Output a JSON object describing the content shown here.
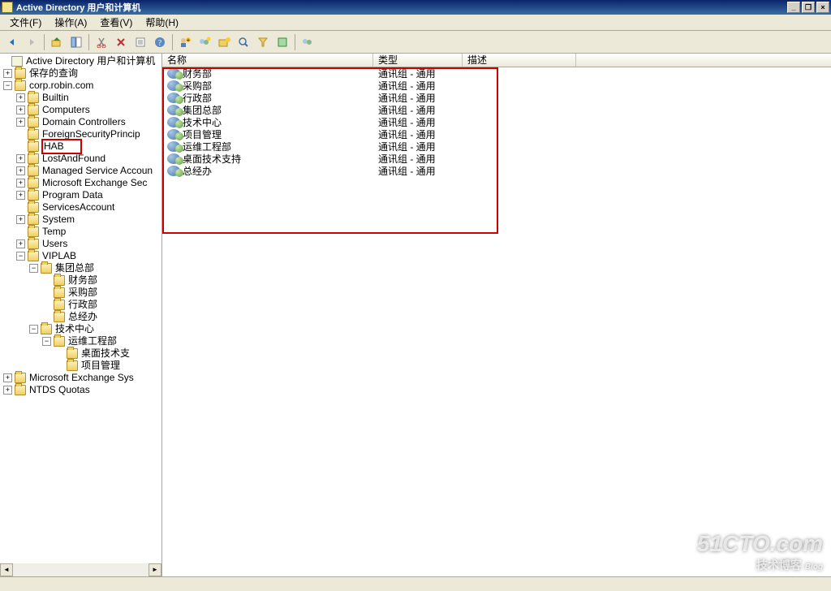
{
  "window": {
    "title": "Active Directory 用户和计算机"
  },
  "menu": {
    "file": "文件(F)",
    "action": "操作(A)",
    "view": "查看(V)",
    "help": "帮助(H)"
  },
  "tree": {
    "root": "Active Directory 用户和计算机",
    "saved_queries": "保存的查询",
    "domain": "corp.robin.com",
    "builtin": "Builtin",
    "computers": "Computers",
    "domain_controllers": "Domain Controllers",
    "foreign_sp": "ForeignSecurityPrincip",
    "hab": "HAB",
    "lostandfound": "LostAndFound",
    "managed_svc": "Managed Service Accoun",
    "ms_exch_sec": "Microsoft Exchange Sec",
    "program_data": "Program Data",
    "services_account": "ServicesAccount",
    "system": "System",
    "temp": "Temp",
    "users": "Users",
    "viplab": "VIPLAB",
    "grp_hq": "集团总部",
    "dept_finance": "财务部",
    "dept_purchase": "采购部",
    "dept_admin": "行政部",
    "dept_gm": "总经办",
    "tech_center": "技术中心",
    "ops_eng": "运维工程部",
    "desktop_support": "桌面技术支",
    "proj_mgmt": "项目管理",
    "ms_exch_sys": "Microsoft Exchange Sys",
    "ntds_quotas": "NTDS Quotas"
  },
  "columns": {
    "name": "名称",
    "type": "类型",
    "desc": "描述"
  },
  "list": [
    {
      "name": "财务部",
      "type": "通讯组 - 通用"
    },
    {
      "name": "采购部",
      "type": "通讯组 - 通用"
    },
    {
      "name": "行政部",
      "type": "通讯组 - 通用"
    },
    {
      "name": "集团总部",
      "type": "通讯组 - 通用"
    },
    {
      "name": "技术中心",
      "type": "通讯组 - 通用"
    },
    {
      "name": "项目管理",
      "type": "通讯组 - 通用"
    },
    {
      "name": "运维工程部",
      "type": "通讯组 - 通用"
    },
    {
      "name": "桌面技术支持",
      "type": "通讯组 - 通用"
    },
    {
      "name": "总经办",
      "type": "通讯组 - 通用"
    }
  ],
  "watermark": {
    "big": "51CTO.com",
    "small": "技术博客",
    "tag": "Blog"
  }
}
